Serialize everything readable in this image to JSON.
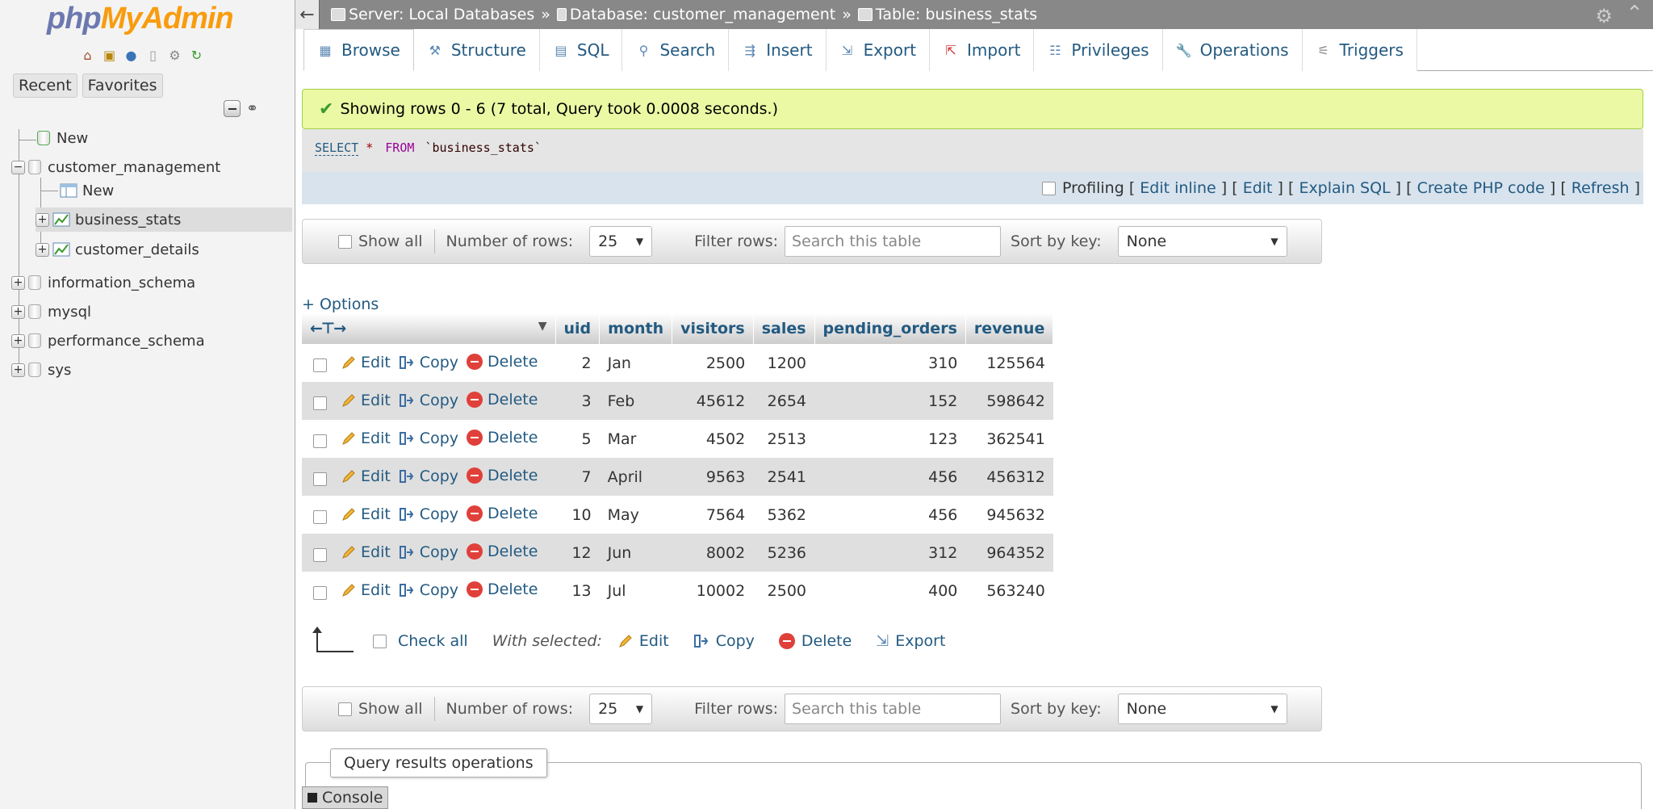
{
  "nav": {
    "logo_php": "php",
    "logo_my": "MyAdmin",
    "tabs": [
      "Recent",
      "Favorites"
    ],
    "tree": [
      {
        "label": "New"
      },
      {
        "label": "customer_management"
      },
      {
        "label": "New"
      },
      {
        "label": "business_stats"
      },
      {
        "label": "customer_details"
      },
      {
        "label": "information_schema"
      },
      {
        "label": "mysql"
      },
      {
        "label": "performance_schema"
      },
      {
        "label": "sys"
      }
    ]
  },
  "breadcrumb": {
    "server": "Server: Local Databases",
    "database": "Database: customer_management",
    "table": "Table: business_stats",
    "separator": "»"
  },
  "tabs": [
    "Browse",
    "Structure",
    "SQL",
    "Search",
    "Insert",
    "Export",
    "Import",
    "Privileges",
    "Operations",
    "Triggers"
  ],
  "message": "Showing rows 0 - 6 (7 total, Query took 0.0008 seconds.)",
  "sql": {
    "keyword": "SELECT",
    "star": "*",
    "from": "FROM",
    "table": "`business_stats`"
  },
  "sql_tools": {
    "profiling": "Profiling",
    "edit_inline": "Edit inline",
    "edit": "Edit",
    "explain": "Explain SQL",
    "php": "Create PHP code",
    "refresh": "Refresh"
  },
  "navbar": {
    "show_all": "Show all",
    "num_rows_label": "Number of rows:",
    "num_rows_value": "25",
    "filter_label": "Filter rows:",
    "filter_placeholder": "Search this table",
    "sort_label": "Sort by key:",
    "sort_value": "None"
  },
  "options_label": "+ Options",
  "table": {
    "columns": [
      "uid",
      "month",
      "visitors",
      "sales",
      "pending_orders",
      "revenue"
    ],
    "actions": [
      "Edit",
      "Copy",
      "Delete"
    ],
    "rows": [
      [
        "2",
        "Jan",
        "2500",
        "1200",
        "310",
        "125564"
      ],
      [
        "3",
        "Feb",
        "45612",
        "2654",
        "152",
        "598642"
      ],
      [
        "5",
        "Mar",
        "4502",
        "2513",
        "123",
        "362541"
      ],
      [
        "7",
        "April",
        "9563",
        "2541",
        "456",
        "456312"
      ],
      [
        "10",
        "May",
        "7564",
        "5362",
        "456",
        "945632"
      ],
      [
        "12",
        "Jun",
        "8002",
        "5236",
        "312",
        "964352"
      ],
      [
        "13",
        "Jul",
        "10002",
        "2500",
        "400",
        "563240"
      ]
    ]
  },
  "bulk": {
    "check_all": "Check all",
    "with_selected": "With selected:",
    "edit": "Edit",
    "copy": "Copy",
    "delete": "Delete",
    "export": "Export"
  },
  "qro_legend": "Query results operations",
  "console_label": "Console"
}
